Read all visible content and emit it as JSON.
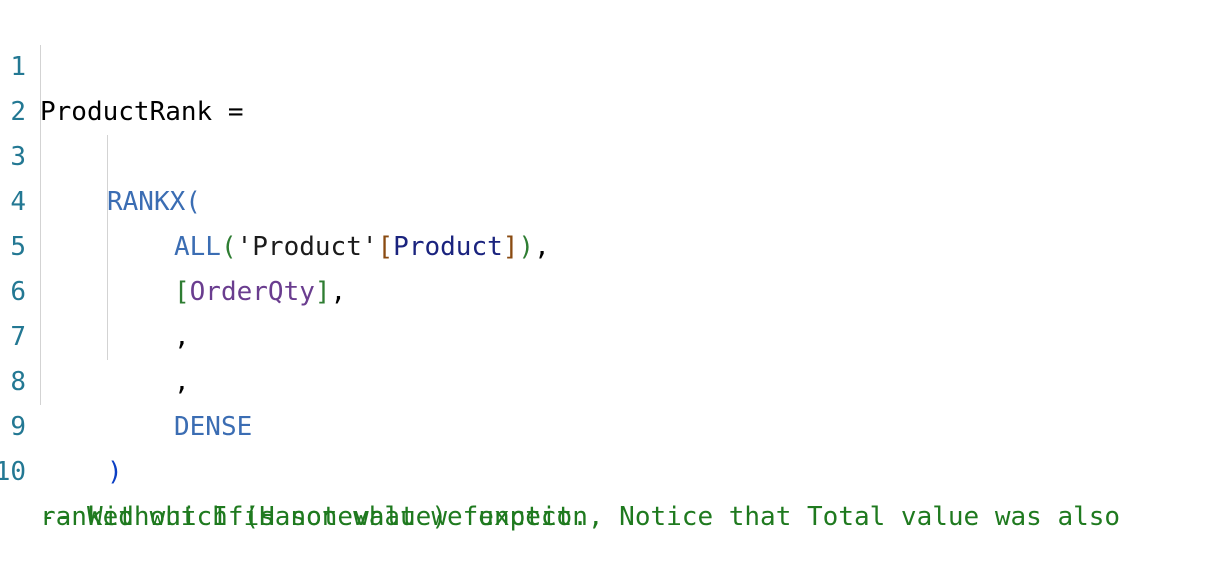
{
  "editor": {
    "line_numbers": [
      "1",
      "2",
      "3",
      "4",
      "5",
      "6",
      "7",
      "8",
      "9",
      "10"
    ],
    "lines": {
      "l1": {
        "name": "ProductRank",
        "op": " ="
      },
      "l3": {
        "func": "RANKX",
        "open": "("
      },
      "l4": {
        "func": "ALL",
        "open": "(",
        "table": "'Product'",
        "bopen": "[",
        "column": "Product",
        "bclose": "]",
        "close": ")",
        "comma": ","
      },
      "l5": {
        "bopen": "[",
        "measure": "OrderQty",
        "bclose": "]",
        "comma": ","
      },
      "l6": {
        "comma": ","
      },
      "l7": {
        "comma": ","
      },
      "l8": {
        "keyword": "DENSE"
      },
      "l9": {
        "close": ")"
      },
      "l10": {
        "comment_line1": "-- Without If(Hasonevalue) function, Notice that Total value was also",
        "comment_line2": "ranked which is not what we expect."
      }
    },
    "colors": {
      "line_number": "#237893",
      "keyword": "#3b6db3",
      "comment": "#1f7a1f",
      "measure": "#6a3d8f",
      "column": "#1a237e"
    }
  }
}
